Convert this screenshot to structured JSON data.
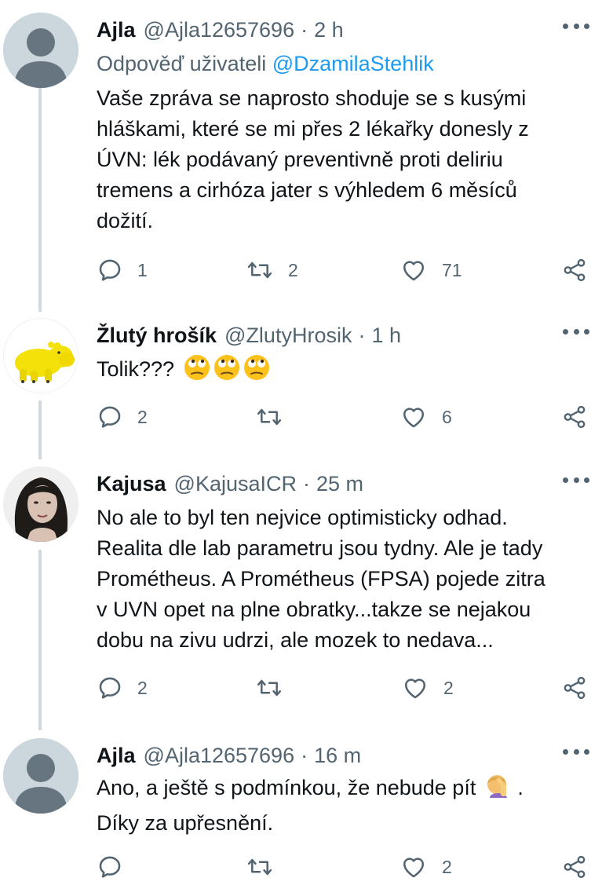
{
  "tweets": [
    {
      "name": "Ajla",
      "handle": "@Ajla12657696",
      "time": "2 h",
      "reply_prefix": "Odpověď uživateli",
      "reply_mention": "@DzamilaStehlik",
      "lines": [
        "Vaše zpráva se naprosto shoduje se s kusými",
        "hláškami, které se mi přes 2 lékařky donesly z",
        "ÚVN: lék podávaný preventivně proti deliriu",
        "tremens a cirhóza jater s výhledem 6 měsíců",
        "dožití."
      ],
      "replies": "1",
      "retweets": "2",
      "likes": "71",
      "avatar_icon": "default-avatar-icon"
    },
    {
      "name": "Žlutý hrošík",
      "handle": "@ZlutyHrosik",
      "time": "1 h",
      "text": "Tolik???",
      "text_emoji": "eye-roll-face-emoji x3",
      "replies": "2",
      "retweets": "",
      "likes": "6",
      "avatar_icon": "yellow-hippo-avatar"
    },
    {
      "name": "Kajusa",
      "handle": "@KajusaICR",
      "time": "25 m",
      "lines": [
        "No ale to byl ten nejvice optimisticky odhad.",
        "Realita dle lab parametru jsou tydny. Ale je tady",
        "Prométheus. A Prométheus (FPSA) pojede zitra",
        "v UVN opet na plne obratky...takze se nejakou",
        "dobu na zivu udrzi, ale mozek to nedava..."
      ],
      "replies": "2",
      "retweets": "",
      "likes": "2",
      "avatar_icon": "woman-portrait-avatar"
    },
    {
      "name": "Ajla",
      "handle": "@Ajla12657696",
      "time": "16 m",
      "lines": [
        "Ano, a ještě s podmínkou, že nebude pít",
        "Díky za upřesnění."
      ],
      "line_end": ".",
      "inline_emoji": "facepalm-woman-emoji",
      "replies": "",
      "retweets": "",
      "likes": "2",
      "avatar_icon": "default-avatar-icon"
    }
  ],
  "sep": "·",
  "icons": [
    "reply-icon",
    "retweet-icon",
    "like-icon",
    "share-icon",
    "more-icon"
  ],
  "colors": {
    "text": "#0f1419",
    "muted": "#536471",
    "link": "#1d9bf0",
    "thread": "#cfd9de"
  }
}
